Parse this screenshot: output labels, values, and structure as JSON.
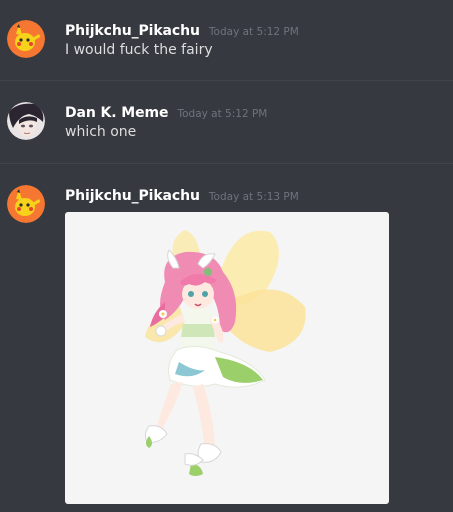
{
  "messages": [
    {
      "username": "Phijkchu_Pikachu",
      "timestamp": "Today at 5:12 PM",
      "text": "I would fuck the fairy",
      "avatar_icon": "pikachu-avatar-icon"
    },
    {
      "username": "Dan K. Meme",
      "timestamp": "Today at 5:12 PM",
      "text": "which one",
      "avatar_icon": "anime-character-avatar-icon"
    },
    {
      "username": "Phijkchu_Pikachu",
      "timestamp": "Today at 5:13 PM",
      "attachment": "fairy-character-image",
      "avatar_icon": "pikachu-avatar-icon"
    }
  ],
  "colors": {
    "background": "#36393f",
    "username": "#ffffff",
    "timestamp": "#6e737c",
    "message_text": "#dcddde",
    "avatar_orange": "#f57731"
  }
}
